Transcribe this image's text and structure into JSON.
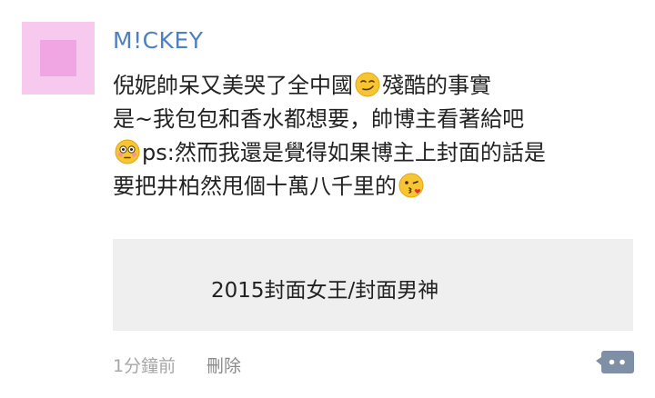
{
  "comment": {
    "username": "M!CKEY",
    "line1_text": "倪妮帥呆又美哭了全中國",
    "line1_tail": "殘酷的事實",
    "line2": "是~我包包和香水都想要，帥博主看著給吧",
    "line3_text": "ps:然而我還是覺得如果博主上封面的話是",
    "line4_text": "要把井柏然甩個十萬八千里的",
    "emoji1": "smirk-emoji",
    "emoji2": "flushed-emoji",
    "emoji3": "kiss-emoji"
  },
  "quote_card": {
    "text": "2015封面女王/封面男神"
  },
  "footer": {
    "timestamp": "1分鐘前",
    "delete_label": "刪除"
  },
  "colors": {
    "username": "#4f7fbf",
    "avatar_light": "#f7c9ef",
    "avatar_dark": "#f0a6e3",
    "card_bg": "#efefef",
    "reply_icon": "#7f8fa6"
  }
}
